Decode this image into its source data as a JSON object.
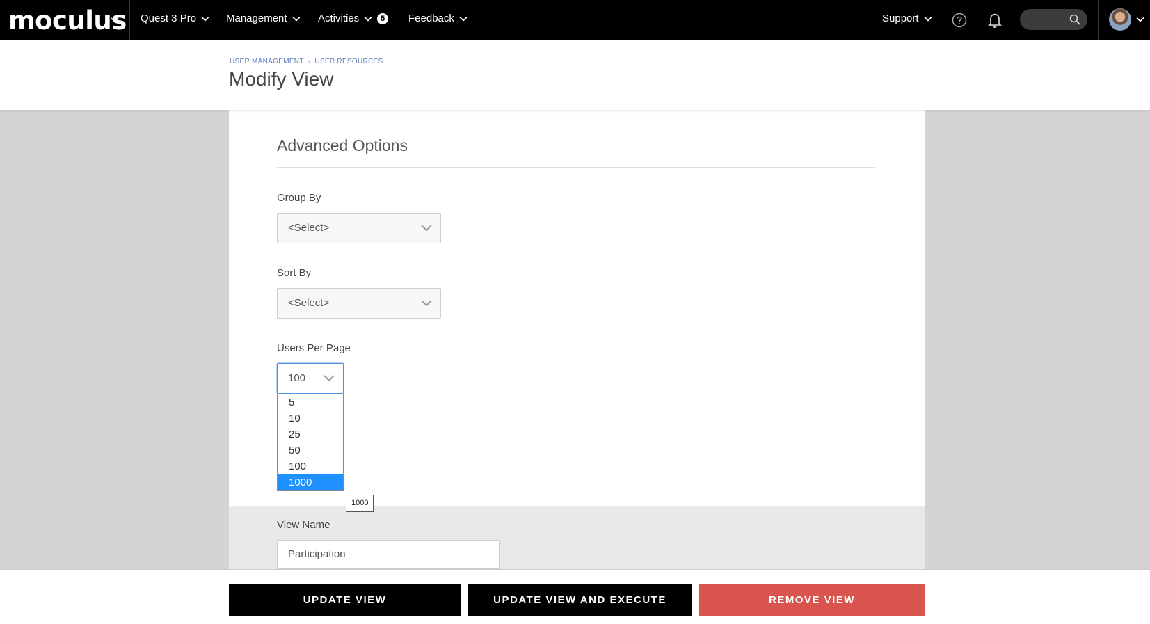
{
  "nav": {
    "logo": "moculus",
    "items": [
      {
        "label": "Quest 3 Pro"
      },
      {
        "label": "Management"
      },
      {
        "label": "Activities",
        "badge": "5"
      },
      {
        "label": "Feedback"
      }
    ],
    "support_label": "Support"
  },
  "header": {
    "breadcrumb": [
      "USER MANAGEMENT",
      "USER RESOURCES"
    ],
    "title": "Modify View"
  },
  "advanced": {
    "section_title": "Advanced Options",
    "group_by": {
      "label": "Group By",
      "value": "<Select>"
    },
    "sort_by": {
      "label": "Sort By",
      "value": "<Select>"
    },
    "users_per_page": {
      "label": "Users Per Page",
      "value": "100",
      "options": [
        "5",
        "10",
        "25",
        "50",
        "100",
        "1000"
      ],
      "highlighted": "1000",
      "tooltip": "1000"
    }
  },
  "view": {
    "name_label": "View Name",
    "name_value": "Participation"
  },
  "footer": {
    "update_label": "UPDATE VIEW",
    "update_execute_label": "UPDATE VIEW AND EXECUTE",
    "remove_label": "REMOVE VIEW"
  },
  "colors": {
    "accent_blue": "#1e90ff",
    "danger": "#d9534f",
    "nav_bg": "#000000"
  }
}
